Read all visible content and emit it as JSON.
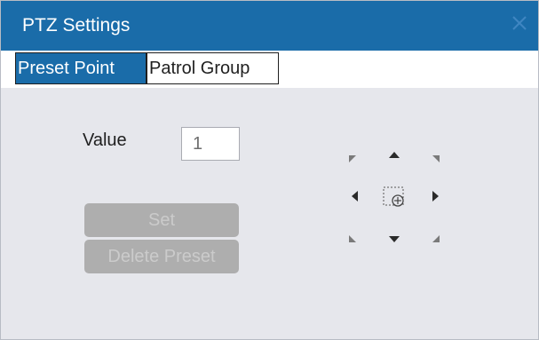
{
  "window": {
    "title": "PTZ Settings",
    "close_icon": "close-x-icon"
  },
  "tabs": [
    {
      "label": "Preset Point",
      "active": true
    },
    {
      "label": "Patrol Group",
      "active": false
    }
  ],
  "preset": {
    "value_label": "Value",
    "value": "1",
    "set_label": "Set",
    "delete_label": "Delete Preset"
  },
  "ptz_pad": {
    "controls": [
      "up-left-arrow-icon",
      "up-arrow-icon",
      "up-right-arrow-icon",
      "left-arrow-icon",
      "center-target-icon",
      "right-arrow-icon",
      "down-left-arrow-icon",
      "down-arrow-icon",
      "down-right-arrow-icon"
    ]
  },
  "colors": {
    "accent": "#1a6ca9",
    "panel": "#e6e7ec",
    "disabled_button": "#aeaeae",
    "disabled_text": "#cbcbcb",
    "arrow_main": "#2a2a2a",
    "arrow_diagonal": "#7a7a7a"
  }
}
